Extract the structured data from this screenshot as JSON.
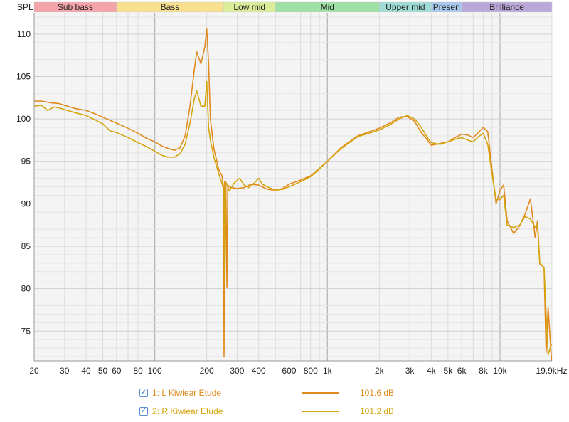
{
  "chart_data": {
    "type": "line",
    "ylabel": "SPL",
    "xscale": "log",
    "xlim": [
      20,
      20000
    ],
    "ylim": [
      71.5,
      112.5
    ],
    "grid": true,
    "x_ticks": [
      {
        "v": 20,
        "label": "20"
      },
      {
        "v": 30,
        "label": "30"
      },
      {
        "v": 40,
        "label": "40"
      },
      {
        "v": 50,
        "label": "50"
      },
      {
        "v": 60,
        "label": "60"
      },
      {
        "v": 80,
        "label": "80"
      },
      {
        "v": 100,
        "label": "100"
      },
      {
        "v": 200,
        "label": "200"
      },
      {
        "v": 300,
        "label": "300"
      },
      {
        "v": 400,
        "label": "400"
      },
      {
        "v": 600,
        "label": "600"
      },
      {
        "v": 800,
        "label": "800"
      },
      {
        "v": 1000,
        "label": "1k"
      },
      {
        "v": 2000,
        "label": "2k"
      },
      {
        "v": 3000,
        "label": "3k"
      },
      {
        "v": 4000,
        "label": "4k"
      },
      {
        "v": 5000,
        "label": "5k"
      },
      {
        "v": 6000,
        "label": "6k"
      },
      {
        "v": 8000,
        "label": "8k"
      },
      {
        "v": 10000,
        "label": "10k"
      },
      {
        "v": 19900,
        "label": "19.9kHz"
      }
    ],
    "y_ticks": [
      75,
      80,
      85,
      90,
      95,
      100,
      105,
      110
    ],
    "bands": [
      {
        "label": "Sub bass",
        "from": 20,
        "to": 60,
        "color": "#f4a3a8"
      },
      {
        "label": "Bass",
        "from": 60,
        "to": 250,
        "color": "#f8e08e"
      },
      {
        "label": "Low mid",
        "from": 250,
        "to": 500,
        "color": "#dbed9a"
      },
      {
        "label": "Mid",
        "from": 500,
        "to": 2000,
        "color": "#9fe0a4"
      },
      {
        "label": "Upper mid",
        "from": 2000,
        "to": 4000,
        "color": "#9fdcd6"
      },
      {
        "label": "Presen",
        "from": 4000,
        "to": 6000,
        "color": "#a9c8ee"
      },
      {
        "label": "Brilliance",
        "from": 6000,
        "to": 20000,
        "color": "#b9a8d8"
      }
    ],
    "series": [
      {
        "name": "1: L Kiwiear Etude",
        "color": "#e08a1e",
        "value": "101.6 dB",
        "points": [
          [
            20,
            102.1
          ],
          [
            22,
            102.1
          ],
          [
            25,
            101.9
          ],
          [
            28,
            101.8
          ],
          [
            30,
            101.6
          ],
          [
            35,
            101.2
          ],
          [
            40,
            101.0
          ],
          [
            45,
            100.6
          ],
          [
            50,
            100.2
          ],
          [
            60,
            99.5
          ],
          [
            70,
            98.9
          ],
          [
            80,
            98.3
          ],
          [
            90,
            97.7
          ],
          [
            100,
            97.3
          ],
          [
            110,
            96.8
          ],
          [
            120,
            96.5
          ],
          [
            130,
            96.3
          ],
          [
            140,
            96.6
          ],
          [
            150,
            98.0
          ],
          [
            160,
            101.5
          ],
          [
            170,
            106.0
          ],
          [
            175,
            107.9
          ],
          [
            185,
            106.5
          ],
          [
            195,
            108.5
          ],
          [
            200,
            110.6
          ],
          [
            205,
            106.5
          ],
          [
            210,
            100.0
          ],
          [
            220,
            96.5
          ],
          [
            235,
            94.0
          ],
          [
            245,
            93.3
          ],
          [
            250,
            92.0
          ],
          [
            252,
            72.0
          ],
          [
            254,
            92.6
          ],
          [
            258,
            92.4
          ],
          [
            262,
            80.2
          ],
          [
            265,
            92.2
          ],
          [
            270,
            92.0
          ],
          [
            280,
            91.9
          ],
          [
            300,
            91.8
          ],
          [
            330,
            91.9
          ],
          [
            360,
            92.3
          ],
          [
            400,
            92.2
          ],
          [
            450,
            91.7
          ],
          [
            500,
            91.6
          ],
          [
            550,
            91.8
          ],
          [
            600,
            92.3
          ],
          [
            700,
            92.8
          ],
          [
            800,
            93.3
          ],
          [
            900,
            94.2
          ],
          [
            1000,
            95.0
          ],
          [
            1200,
            96.6
          ],
          [
            1500,
            98.0
          ],
          [
            2000,
            98.9
          ],
          [
            2300,
            99.5
          ],
          [
            2600,
            100.2
          ],
          [
            2900,
            100.3
          ],
          [
            3200,
            99.7
          ],
          [
            3500,
            98.4
          ],
          [
            3800,
            97.5
          ],
          [
            4000,
            96.9
          ],
          [
            4500,
            97.1
          ],
          [
            5000,
            97.3
          ],
          [
            5500,
            97.8
          ],
          [
            6000,
            98.2
          ],
          [
            6500,
            98.1
          ],
          [
            7000,
            97.8
          ],
          [
            7500,
            98.4
          ],
          [
            8000,
            99.0
          ],
          [
            8500,
            98.5
          ],
          [
            9000,
            94.0
          ],
          [
            9500,
            90.0
          ],
          [
            10000,
            91.6
          ],
          [
            10500,
            92.2
          ],
          [
            11000,
            88.0
          ],
          [
            12000,
            86.5
          ],
          [
            13000,
            87.4
          ],
          [
            14000,
            88.8
          ],
          [
            15000,
            90.6
          ],
          [
            16000,
            86.0
          ],
          [
            16500,
            88.0
          ],
          [
            17000,
            82.9
          ],
          [
            18000,
            82.5
          ],
          [
            18500,
            72.5
          ],
          [
            19000,
            77.8
          ],
          [
            19900,
            71.5
          ]
        ]
      },
      {
        "name": "2: R Kiwiear Etude",
        "color": "#d4a50c",
        "value": "101.2 dB",
        "points": [
          [
            20,
            101.5
          ],
          [
            22,
            101.6
          ],
          [
            24,
            101.0
          ],
          [
            26,
            101.4
          ],
          [
            28,
            101.3
          ],
          [
            30,
            101.1
          ],
          [
            35,
            100.7
          ],
          [
            40,
            100.4
          ],
          [
            45,
            99.9
          ],
          [
            50,
            99.4
          ],
          [
            55,
            98.6
          ],
          [
            60,
            98.4
          ],
          [
            70,
            97.8
          ],
          [
            80,
            97.2
          ],
          [
            90,
            96.7
          ],
          [
            100,
            96.2
          ],
          [
            110,
            95.7
          ],
          [
            120,
            95.5
          ],
          [
            130,
            95.5
          ],
          [
            140,
            95.9
          ],
          [
            150,
            97.0
          ],
          [
            160,
            99.5
          ],
          [
            170,
            102.5
          ],
          [
            175,
            103.3
          ],
          [
            185,
            101.5
          ],
          [
            195,
            101.5
          ],
          [
            200,
            104.4
          ],
          [
            205,
            99.0
          ],
          [
            210,
            97.5
          ],
          [
            220,
            95.5
          ],
          [
            235,
            93.5
          ],
          [
            245,
            92.4
          ],
          [
            250,
            91.8
          ],
          [
            252,
            91.5
          ],
          [
            253,
            85.0
          ],
          [
            255,
            80.2
          ],
          [
            257,
            92.6
          ],
          [
            262,
            92.3
          ],
          [
            270,
            91.5
          ],
          [
            290,
            92.5
          ],
          [
            310,
            93.0
          ],
          [
            330,
            92.2
          ],
          [
            350,
            91.9
          ],
          [
            380,
            92.5
          ],
          [
            400,
            93.0
          ],
          [
            420,
            92.3
          ],
          [
            460,
            91.9
          ],
          [
            500,
            91.6
          ],
          [
            550,
            91.7
          ],
          [
            600,
            92.0
          ],
          [
            700,
            92.6
          ],
          [
            800,
            93.2
          ],
          [
            900,
            94.1
          ],
          [
            1000,
            95.0
          ],
          [
            1200,
            96.5
          ],
          [
            1500,
            97.9
          ],
          [
            2000,
            98.7
          ],
          [
            2300,
            99.3
          ],
          [
            2600,
            100.0
          ],
          [
            2900,
            100.4
          ],
          [
            3200,
            100.0
          ],
          [
            3500,
            99.0
          ],
          [
            3800,
            97.8
          ],
          [
            4000,
            97.2
          ],
          [
            4500,
            97.0
          ],
          [
            5000,
            97.3
          ],
          [
            5500,
            97.6
          ],
          [
            6000,
            97.8
          ],
          [
            6500,
            97.5
          ],
          [
            7000,
            97.3
          ],
          [
            7500,
            97.9
          ],
          [
            8000,
            98.3
          ],
          [
            8500,
            97.0
          ],
          [
            9000,
            93.5
          ],
          [
            9500,
            90.5
          ],
          [
            10000,
            90.5
          ],
          [
            10500,
            91.0
          ],
          [
            11000,
            87.5
          ],
          [
            12000,
            87.2
          ],
          [
            13000,
            87.5
          ],
          [
            14000,
            88.5
          ],
          [
            15000,
            88.2
          ],
          [
            16000,
            87.2
          ],
          [
            16500,
            87.5
          ],
          [
            17000,
            83.0
          ],
          [
            18000,
            82.5
          ],
          [
            18500,
            77.0
          ],
          [
            19000,
            72.2
          ],
          [
            19900,
            73.5
          ]
        ]
      }
    ]
  }
}
